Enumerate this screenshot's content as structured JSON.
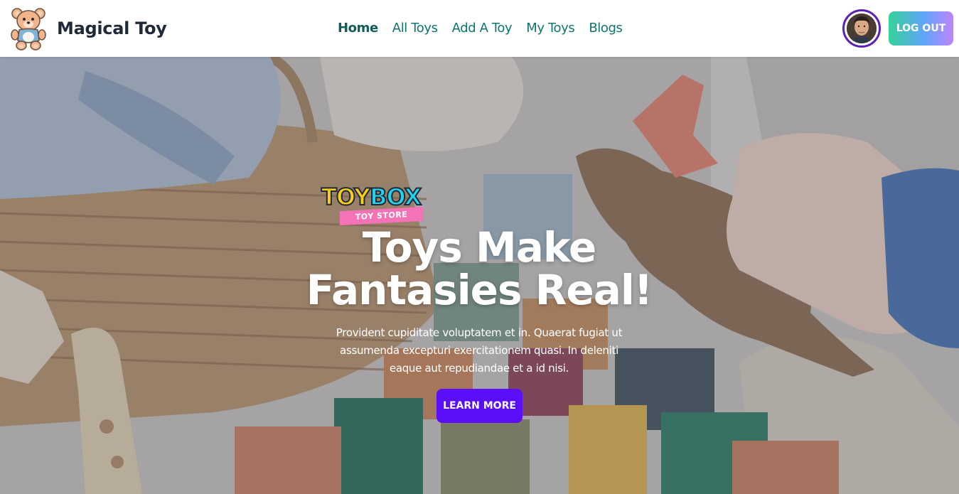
{
  "navbar": {
    "brand_name": "Magical Toy",
    "brand_logo_icon": "teddy-bear-icon",
    "links": [
      {
        "label": "Home",
        "active": true
      },
      {
        "label": "All Toys",
        "active": false
      },
      {
        "label": "Add A Toy",
        "active": false
      },
      {
        "label": "My Toys",
        "active": false
      },
      {
        "label": "Blogs",
        "active": false
      }
    ],
    "logout_label": "LOG OUT",
    "avatar_icon": "user-avatar"
  },
  "hero": {
    "logo": {
      "word_part1": "TOY",
      "word_part2": "BOX",
      "tagline": "TOY STORE"
    },
    "title_line1": "Toys Make",
    "title_line2": "Fantasies Real!",
    "description": "Provident cupiditate voluptatem et in. Quaerat fugiat ut assumenda excepturi exercitationem quasi. In deleniti eaque aut repudiandae et a id nisi.",
    "cta_label": "LEARN MORE"
  },
  "colors": {
    "nav_link": "#0f766e",
    "cta": "#5b0ef9",
    "avatar_ring": "#5b21b6",
    "logout_gradient": [
      "#34d399",
      "#60a5fa",
      "#c084fc"
    ]
  }
}
